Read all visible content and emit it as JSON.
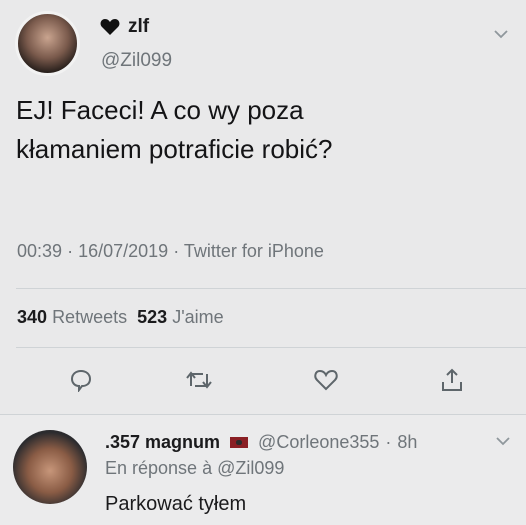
{
  "tweet": {
    "display_name": "zlf",
    "handle": "@Zil099",
    "text_line1": "EJ! Faceci! A co wy poza",
    "text_line2": "kłamaniem potraficie robić?",
    "time": "00:39",
    "date": "16/07/2019",
    "source": "Twitter for iPhone",
    "retweets_count": "340",
    "retweets_label": "Retweets",
    "likes_count": "523",
    "likes_label": "J'aime",
    "sep": "·"
  },
  "reply": {
    "display_name": ".357 magnum",
    "handle": "@Corleone355",
    "time": "8h",
    "in_reply_prefix": "En réponse à",
    "in_reply_handle": "@Zil099",
    "text": "Parkować tyłem",
    "sep": "·"
  },
  "icons": [
    "black-heart-icon",
    "chevron-down-icon",
    "reply-icon",
    "retweet-icon",
    "like-icon",
    "share-icon",
    "flag-icon"
  ],
  "colors": {
    "background": "#e9e9ea",
    "secondary_text": "#6f757a",
    "primary_text": "#1b1b1d",
    "flag": "#8a1f24"
  }
}
